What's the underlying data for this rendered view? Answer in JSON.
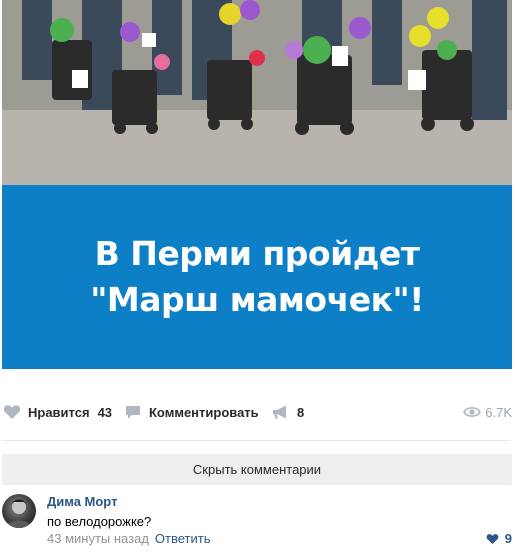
{
  "post": {
    "banner_line1": "В Перми пройдет",
    "banner_line2": "\"Марш мамочек\"!"
  },
  "actions": {
    "like_label": "Нравится",
    "like_count": "43",
    "comment_label": "Комментировать",
    "share_count": "8",
    "views_count": "6.7K"
  },
  "comments": {
    "hide_label": "Скрыть комментарии",
    "items": [
      {
        "author": "Дима Морт",
        "text": "по велодорожке?",
        "time": "43 минуты назад",
        "reply_label": "Ответить",
        "likes": "9"
      }
    ]
  },
  "colors": {
    "banner": "#0d7fc6",
    "link": "#2a5885",
    "muted": "#939393",
    "bar": "#edeef0"
  },
  "icons": [
    "heart-icon",
    "comment-icon",
    "megaphone-icon",
    "eye-icon"
  ]
}
